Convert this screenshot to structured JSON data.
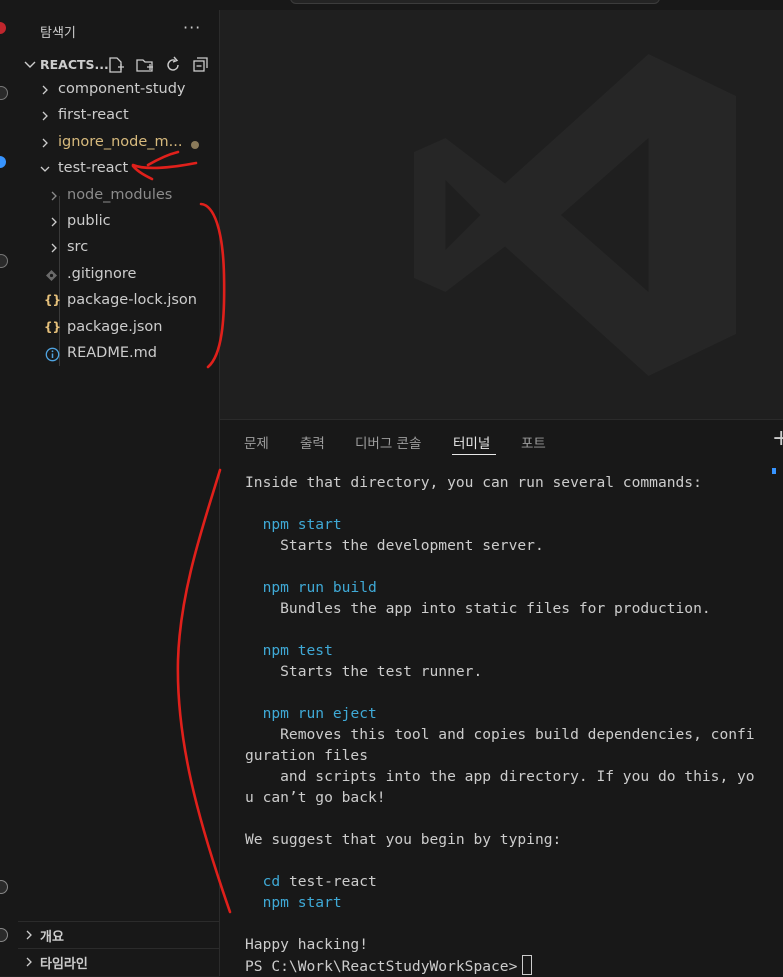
{
  "sidebar": {
    "title": "탐색기",
    "more_label": "···",
    "workspace": "REACTS...",
    "tree": [
      {
        "label": "component-study",
        "type": "folder"
      },
      {
        "label": "first-react",
        "type": "folder"
      },
      {
        "label": "ignore_node_m...",
        "type": "folder"
      },
      {
        "label": "test-react",
        "type": "folder-open"
      },
      {
        "label": "node_modules",
        "type": "folder"
      },
      {
        "label": "public",
        "type": "folder"
      },
      {
        "label": "src",
        "type": "folder"
      },
      {
        "label": ".gitignore",
        "type": "file"
      },
      {
        "label": "package-lock.json",
        "type": "file"
      },
      {
        "label": "package.json",
        "type": "file"
      },
      {
        "label": "README.md",
        "type": "file"
      }
    ],
    "outline_label": "개요",
    "timeline_label": "타임라인"
  },
  "panel": {
    "tabs": [
      "문제",
      "출력",
      "디버그 콘솔",
      "터미널",
      "포트"
    ],
    "active_tab": "터미널"
  },
  "terminal": {
    "lines": [
      {
        "text": "Inside that directory, you can run several commands:"
      },
      {
        "text": ""
      },
      {
        "cmd": "npm",
        "arg": " start"
      },
      {
        "text": "    Starts the development server."
      },
      {
        "text": ""
      },
      {
        "cmd": "npm",
        "arg": " run build"
      },
      {
        "text": "    Bundles the app into static files for production."
      },
      {
        "text": ""
      },
      {
        "cmd": "npm",
        "arg": " test"
      },
      {
        "text": "    Starts the test runner."
      },
      {
        "text": ""
      },
      {
        "cmd": "npm",
        "arg": " run eject"
      },
      {
        "text": "    Removes this tool and copies build dependencies, confi"
      },
      {
        "text": "guration files"
      },
      {
        "text": "    and scripts into the app directory. If you do this, yo"
      },
      {
        "text": "u can’t go back!"
      },
      {
        "text": ""
      },
      {
        "text": "We suggest that you begin by typing:"
      },
      {
        "text": ""
      },
      {
        "cmd": "cd",
        "arg": " test-react"
      },
      {
        "cmd": "npm",
        "arg": " start"
      },
      {
        "text": ""
      },
      {
        "text": "Happy hacking!"
      }
    ],
    "prompt": "PS C:\\Work\\ReactStudyWorkSpace>"
  },
  "colors": {
    "accent_blue": "#3794ff",
    "command": "#3fa9d6",
    "annotation_red": "#e0201b",
    "json_icon": "#e5c07b",
    "info_icon": "#4fa3e0"
  },
  "icons": [
    "chevron-right-icon",
    "chevron-down-icon",
    "new-file-icon",
    "new-folder-icon",
    "refresh-icon",
    "collapse-all-icon",
    "git-icon",
    "json-icon",
    "info-icon",
    "vscode-logo-icon",
    "add-terminal-icon"
  ]
}
